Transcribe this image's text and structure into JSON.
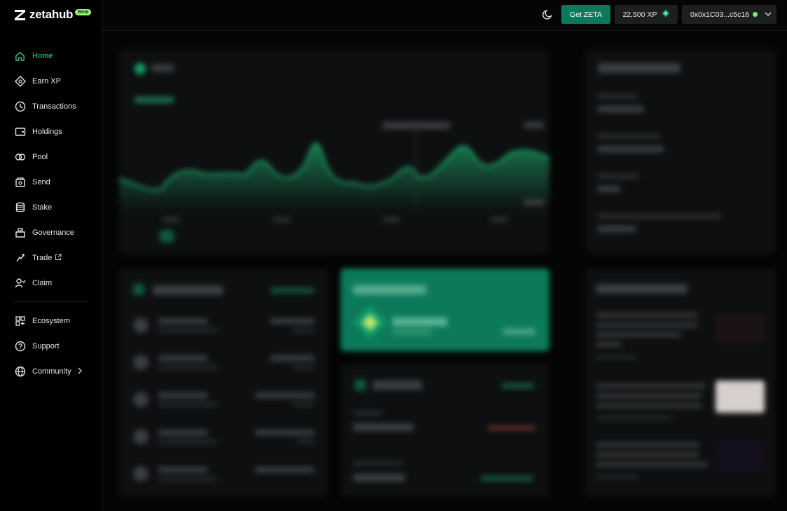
{
  "app": {
    "name": "zetahub",
    "badge": "Beta"
  },
  "sidebar": {
    "items": [
      {
        "label": "Home",
        "icon": "home-icon",
        "active": true
      },
      {
        "label": "Earn XP",
        "icon": "diamond-icon"
      },
      {
        "label": "Transactions",
        "icon": "clock-icon"
      },
      {
        "label": "Holdings",
        "icon": "wallet-icon"
      },
      {
        "label": "Pool",
        "icon": "pool-icon"
      },
      {
        "label": "Send",
        "icon": "send-icon"
      },
      {
        "label": "Stake",
        "icon": "database-icon"
      },
      {
        "label": "Governance",
        "icon": "ballot-icon"
      },
      {
        "label": "Trade",
        "icon": "trade-icon",
        "external": true
      }
    ],
    "items2": [
      {
        "label": "Claim",
        "icon": "claim-icon"
      }
    ],
    "secondary": [
      {
        "label": "Ecosystem",
        "icon": "grid-plus-icon"
      },
      {
        "label": "Support",
        "icon": "help-icon"
      },
      {
        "label": "Community",
        "icon": "globe-icon",
        "has_chevron": true
      }
    ]
  },
  "header": {
    "get_zeta_label": "Get ZETA",
    "xp_label": "22,500 XP",
    "wallet_address": "0x0x1C03...c5c16"
  },
  "colors": {
    "accent": "#0c7a5a",
    "active_text": "#3fd190",
    "badge": "#9ef07a",
    "status_dot": "#7ef06a"
  }
}
